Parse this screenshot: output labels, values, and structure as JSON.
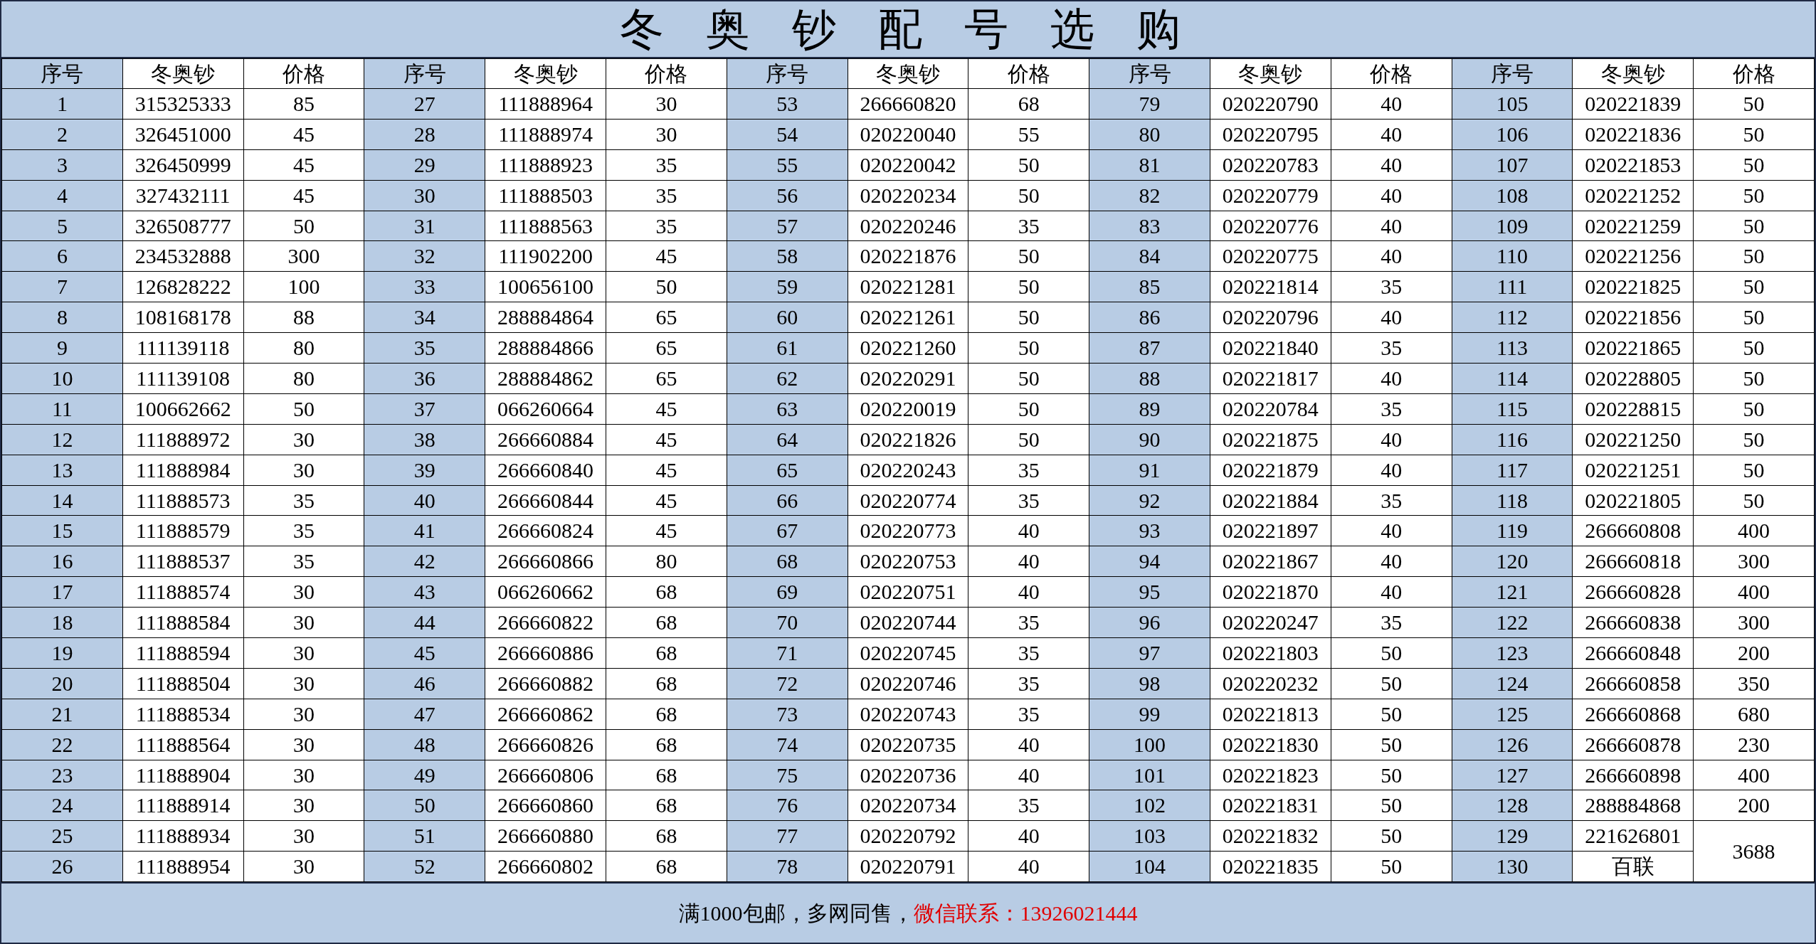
{
  "title": "冬 奥 钞 配 号 选 购",
  "groups": [
    {
      "headers": [
        "序号",
        "冬奥钞",
        "价格"
      ],
      "rows": [
        {
          "no": "1",
          "code": "315325333",
          "price": "85"
        },
        {
          "no": "2",
          "code": "326451000",
          "price": "45"
        },
        {
          "no": "3",
          "code": "326450999",
          "price": "45"
        },
        {
          "no": "4",
          "code": "327432111",
          "price": "45"
        },
        {
          "no": "5",
          "code": "326508777",
          "price": "50"
        },
        {
          "no": "6",
          "code": "234532888",
          "price": "300"
        },
        {
          "no": "7",
          "code": "126828222",
          "price": "100"
        },
        {
          "no": "8",
          "code": "108168178",
          "price": "88"
        },
        {
          "no": "9",
          "code": "111139118",
          "price": "80"
        },
        {
          "no": "10",
          "code": "111139108",
          "price": "80"
        },
        {
          "no": "11",
          "code": "100662662",
          "price": "50"
        },
        {
          "no": "12",
          "code": "111888972",
          "price": "30"
        },
        {
          "no": "13",
          "code": "111888984",
          "price": "30"
        },
        {
          "no": "14",
          "code": "111888573",
          "price": "35"
        },
        {
          "no": "15",
          "code": "111888579",
          "price": "35"
        },
        {
          "no": "16",
          "code": "111888537",
          "price": "35"
        },
        {
          "no": "17",
          "code": "111888574",
          "price": "30"
        },
        {
          "no": "18",
          "code": "111888584",
          "price": "30"
        },
        {
          "no": "19",
          "code": "111888594",
          "price": "30"
        },
        {
          "no": "20",
          "code": "111888504",
          "price": "30"
        },
        {
          "no": "21",
          "code": "111888534",
          "price": "30"
        },
        {
          "no": "22",
          "code": "111888564",
          "price": "30"
        },
        {
          "no": "23",
          "code": "111888904",
          "price": "30"
        },
        {
          "no": "24",
          "code": "111888914",
          "price": "30"
        },
        {
          "no": "25",
          "code": "111888934",
          "price": "30"
        },
        {
          "no": "26",
          "code": "111888954",
          "price": "30"
        }
      ]
    },
    {
      "headers": [
        "序号",
        "冬奥钞",
        "价格"
      ],
      "rows": [
        {
          "no": "27",
          "code": "111888964",
          "price": "30"
        },
        {
          "no": "28",
          "code": "111888974",
          "price": "30"
        },
        {
          "no": "29",
          "code": "111888923",
          "price": "35"
        },
        {
          "no": "30",
          "code": "111888503",
          "price": "35"
        },
        {
          "no": "31",
          "code": "111888563",
          "price": "35"
        },
        {
          "no": "32",
          "code": "111902200",
          "price": "45"
        },
        {
          "no": "33",
          "code": "100656100",
          "price": "50"
        },
        {
          "no": "34",
          "code": "288884864",
          "price": "65"
        },
        {
          "no": "35",
          "code": "288884866",
          "price": "65"
        },
        {
          "no": "36",
          "code": "288884862",
          "price": "65"
        },
        {
          "no": "37",
          "code": "066260664",
          "price": "45"
        },
        {
          "no": "38",
          "code": "266660884",
          "price": "45"
        },
        {
          "no": "39",
          "code": "266660840",
          "price": "45"
        },
        {
          "no": "40",
          "code": "266660844",
          "price": "45"
        },
        {
          "no": "41",
          "code": "266660824",
          "price": "45"
        },
        {
          "no": "42",
          "code": "266660866",
          "price": "80"
        },
        {
          "no": "43",
          "code": "066260662",
          "price": "68"
        },
        {
          "no": "44",
          "code": "266660822",
          "price": "68"
        },
        {
          "no": "45",
          "code": "266660886",
          "price": "68"
        },
        {
          "no": "46",
          "code": "266660882",
          "price": "68"
        },
        {
          "no": "47",
          "code": "266660862",
          "price": "68"
        },
        {
          "no": "48",
          "code": "266660826",
          "price": "68"
        },
        {
          "no": "49",
          "code": "266660806",
          "price": "68"
        },
        {
          "no": "50",
          "code": "266660860",
          "price": "68"
        },
        {
          "no": "51",
          "code": "266660880",
          "price": "68"
        },
        {
          "no": "52",
          "code": "266660802",
          "price": "68"
        }
      ]
    },
    {
      "headers": [
        "序号",
        "冬奥钞",
        "价格"
      ],
      "rows": [
        {
          "no": "53",
          "code": "266660820",
          "price": "68"
        },
        {
          "no": "54",
          "code": "020220040",
          "price": "55"
        },
        {
          "no": "55",
          "code": "020220042",
          "price": "50"
        },
        {
          "no": "56",
          "code": "020220234",
          "price": "50"
        },
        {
          "no": "57",
          "code": "020220246",
          "price": "35"
        },
        {
          "no": "58",
          "code": "020221876",
          "price": "50"
        },
        {
          "no": "59",
          "code": "020221281",
          "price": "50"
        },
        {
          "no": "60",
          "code": "020221261",
          "price": "50"
        },
        {
          "no": "61",
          "code": "020221260",
          "price": "50"
        },
        {
          "no": "62",
          "code": "020220291",
          "price": "50"
        },
        {
          "no": "63",
          "code": "020220019",
          "price": "50"
        },
        {
          "no": "64",
          "code": "020221826",
          "price": "50"
        },
        {
          "no": "65",
          "code": "020220243",
          "price": "35"
        },
        {
          "no": "66",
          "code": "020220774",
          "price": "35"
        },
        {
          "no": "67",
          "code": "020220773",
          "price": "40"
        },
        {
          "no": "68",
          "code": "020220753",
          "price": "40"
        },
        {
          "no": "69",
          "code": "020220751",
          "price": "40"
        },
        {
          "no": "70",
          "code": "020220744",
          "price": "35"
        },
        {
          "no": "71",
          "code": "020220745",
          "price": "35"
        },
        {
          "no": "72",
          "code": "020220746",
          "price": "35"
        },
        {
          "no": "73",
          "code": "020220743",
          "price": "35"
        },
        {
          "no": "74",
          "code": "020220735",
          "price": "40"
        },
        {
          "no": "75",
          "code": "020220736",
          "price": "40"
        },
        {
          "no": "76",
          "code": "020220734",
          "price": "35"
        },
        {
          "no": "77",
          "code": "020220792",
          "price": "40"
        },
        {
          "no": "78",
          "code": "020220791",
          "price": "40"
        }
      ]
    },
    {
      "headers": [
        "序号",
        "冬奥钞",
        "价格"
      ],
      "rows": [
        {
          "no": "79",
          "code": "020220790",
          "price": "40"
        },
        {
          "no": "80",
          "code": "020220795",
          "price": "40"
        },
        {
          "no": "81",
          "code": "020220783",
          "price": "40"
        },
        {
          "no": "82",
          "code": "020220779",
          "price": "40"
        },
        {
          "no": "83",
          "code": "020220776",
          "price": "40"
        },
        {
          "no": "84",
          "code": "020220775",
          "price": "40"
        },
        {
          "no": "85",
          "code": "020221814",
          "price": "35"
        },
        {
          "no": "86",
          "code": "020220796",
          "price": "40"
        },
        {
          "no": "87",
          "code": "020221840",
          "price": "35"
        },
        {
          "no": "88",
          "code": "020221817",
          "price": "40"
        },
        {
          "no": "89",
          "code": "020220784",
          "price": "35"
        },
        {
          "no": "90",
          "code": "020221875",
          "price": "40"
        },
        {
          "no": "91",
          "code": "020221879",
          "price": "40"
        },
        {
          "no": "92",
          "code": "020221884",
          "price": "35"
        },
        {
          "no": "93",
          "code": "020221897",
          "price": "40"
        },
        {
          "no": "94",
          "code": "020221867",
          "price": "40"
        },
        {
          "no": "95",
          "code": "020221870",
          "price": "40"
        },
        {
          "no": "96",
          "code": "020220247",
          "price": "35"
        },
        {
          "no": "97",
          "code": "020221803",
          "price": "50"
        },
        {
          "no": "98",
          "code": "020220232",
          "price": "50"
        },
        {
          "no": "99",
          "code": "020221813",
          "price": "50"
        },
        {
          "no": "100",
          "code": "020221830",
          "price": "50"
        },
        {
          "no": "101",
          "code": "020221823",
          "price": "50"
        },
        {
          "no": "102",
          "code": "020221831",
          "price": "50"
        },
        {
          "no": "103",
          "code": "020221832",
          "price": "50"
        },
        {
          "no": "104",
          "code": "020221835",
          "price": "50"
        }
      ]
    },
    {
      "headers": [
        "序号",
        "冬奥钞",
        "价格"
      ],
      "rows": [
        {
          "no": "105",
          "code": "020221839",
          "price": "50"
        },
        {
          "no": "106",
          "code": "020221836",
          "price": "50"
        },
        {
          "no": "107",
          "code": "020221853",
          "price": "50"
        },
        {
          "no": "108",
          "code": "020221252",
          "price": "50"
        },
        {
          "no": "109",
          "code": "020221259",
          "price": "50"
        },
        {
          "no": "110",
          "code": "020221256",
          "price": "50"
        },
        {
          "no": "111",
          "code": "020221825",
          "price": "50"
        },
        {
          "no": "112",
          "code": "020221856",
          "price": "50"
        },
        {
          "no": "113",
          "code": "020221865",
          "price": "50"
        },
        {
          "no": "114",
          "code": "020228805",
          "price": "50"
        },
        {
          "no": "115",
          "code": "020228815",
          "price": "50"
        },
        {
          "no": "116",
          "code": "020221250",
          "price": "50"
        },
        {
          "no": "117",
          "code": "020221251",
          "price": "50"
        },
        {
          "no": "118",
          "code": "020221805",
          "price": "50"
        },
        {
          "no": "119",
          "code": "266660808",
          "price": "400"
        },
        {
          "no": "120",
          "code": "266660818",
          "price": "300"
        },
        {
          "no": "121",
          "code": "266660828",
          "price": "400"
        },
        {
          "no": "122",
          "code": "266660838",
          "price": "300"
        },
        {
          "no": "123",
          "code": "266660848",
          "price": "200"
        },
        {
          "no": "124",
          "code": "266660858",
          "price": "350"
        },
        {
          "no": "125",
          "code": "266660868",
          "price": "680"
        },
        {
          "no": "126",
          "code": "266660878",
          "price": "230"
        },
        {
          "no": "127",
          "code": "266660898",
          "price": "400"
        },
        {
          "no": "128",
          "code": "288884868",
          "price": "200"
        },
        {
          "no": "129",
          "code": "221626801",
          "price": "3688",
          "price_spans_next_row": true
        },
        {
          "no": "130",
          "code": "百联"
        }
      ]
    }
  ],
  "footer": {
    "note": "满1000包邮，多网同售，",
    "contact": "微信联系：13926021444"
  }
}
